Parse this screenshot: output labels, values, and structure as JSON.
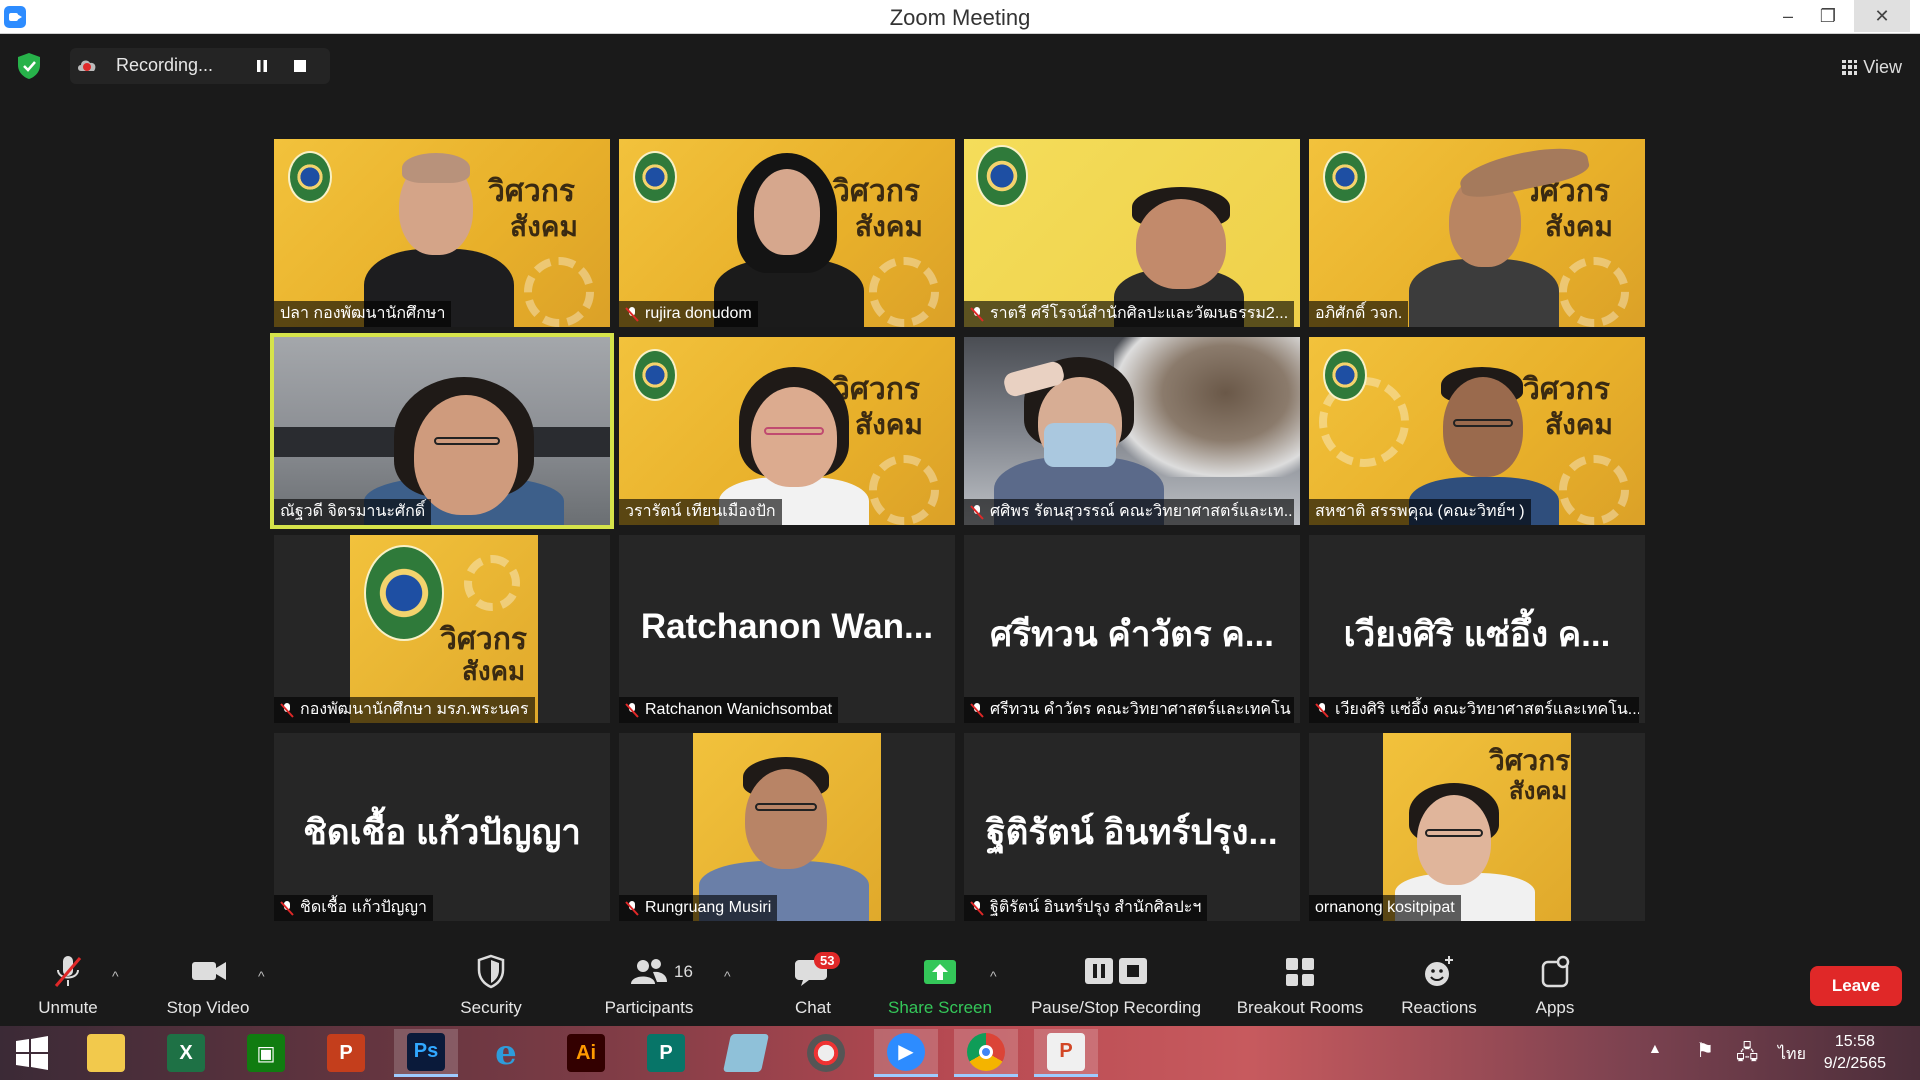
{
  "window": {
    "title": "Zoom Meeting",
    "minimize": "–",
    "restore": "❐",
    "close": "✕"
  },
  "recording": {
    "status": "Recording..."
  },
  "view": {
    "label": "View"
  },
  "participants_tiles": [
    {
      "name": "ปลา กองพัฒนานักศึกษา",
      "muted": false,
      "video": true,
      "speaking": false
    },
    {
      "name": "rujira donudom",
      "muted": true,
      "video": true,
      "speaking": false
    },
    {
      "name": "ราตรี   ศรีโรจน์สำนักศิลปะและวัฒนธรรม2...",
      "muted": true,
      "video": true,
      "speaking": false
    },
    {
      "name": "อภิศักดิ์ วจก.",
      "muted": false,
      "video": true,
      "speaking": false
    },
    {
      "name": "ณัฐวดี จิตรมานะศักดิ์",
      "muted": false,
      "video": true,
      "speaking": true
    },
    {
      "name": "วรารัตน์ เทียนเมืองปัก",
      "muted": false,
      "video": true,
      "speaking": false
    },
    {
      "name": "ศศิพร รัตนสุวรรณ์ คณะวิทยาศาสตร์และเท...",
      "muted": true,
      "video": true,
      "speaking": false
    },
    {
      "name": "สหชาติ สรรพคุณ (คณะวิทย์ฯ )",
      "muted": false,
      "video": true,
      "speaking": false
    },
    {
      "name": "กองพัฒนานักศึกษา มรภ.พระนคร",
      "muted": true,
      "video": true,
      "speaking": false
    },
    {
      "name": "Ratchanon Wanichsombat",
      "big_name": "Ratchanon  Wan...",
      "muted": true,
      "video": false,
      "speaking": false
    },
    {
      "name": "ศรีทวน  คำวัตร คณะวิทยาศาสตร์และเทคโน",
      "big_name": "ศรีทวน  คำวัตร ค...",
      "muted": true,
      "video": false,
      "speaking": false
    },
    {
      "name": "เวียงศิริ  แซ่อึ้ง  คณะวิทยาศาสตร์และเทคโน...",
      "big_name": "เวียงศิริ  แซ่อึ้ง  ค...",
      "muted": true,
      "video": false,
      "speaking": false
    },
    {
      "name": "ชิดเชื้อ แก้วปัญญา",
      "big_name": "ชิดเชื้อ แก้วปัญญา",
      "muted": true,
      "video": false,
      "speaking": false
    },
    {
      "name": "Rungruang Musiri",
      "muted": true,
      "video": true,
      "speaking": false
    },
    {
      "name": "ฐิติรัตน์ อินทร์ปรุง สำนักศิลปะฯ",
      "big_name": "ฐิติรัตน์ อินทร์ปรุง...",
      "muted": true,
      "video": false,
      "speaking": false
    },
    {
      "name": "ornanong kositpipat",
      "muted": false,
      "video": true,
      "speaking": false
    }
  ],
  "banner": {
    "line1": "วิศวกร",
    "line2": "สังคม"
  },
  "toolbar": {
    "unmute": "Unmute",
    "stop_video": "Stop Video",
    "security": "Security",
    "participants": "Participants",
    "participants_count": "16",
    "chat": "Chat",
    "chat_badge": "53",
    "share_screen": "Share Screen",
    "pause_stop_recording": "Pause/Stop Recording",
    "breakout_rooms": "Breakout Rooms",
    "reactions": "Reactions",
    "apps": "Apps",
    "leave": "Leave"
  },
  "taskbar": {
    "language": "ไทย",
    "time": "15:58",
    "date": "9/2/2565",
    "apps": [
      "start",
      "file-explorer",
      "excel",
      "publisher-green",
      "powerpoint",
      "photoshop",
      "internet-explorer",
      "illustrator",
      "publisher",
      "notepad",
      "photoscape",
      "zoom",
      "chrome",
      "powerpoint-alt"
    ]
  },
  "colors": {
    "speaking_outline": "#d6e34a",
    "leave": "#e02828",
    "share": "#34c759",
    "mute_red": "#e02828"
  }
}
